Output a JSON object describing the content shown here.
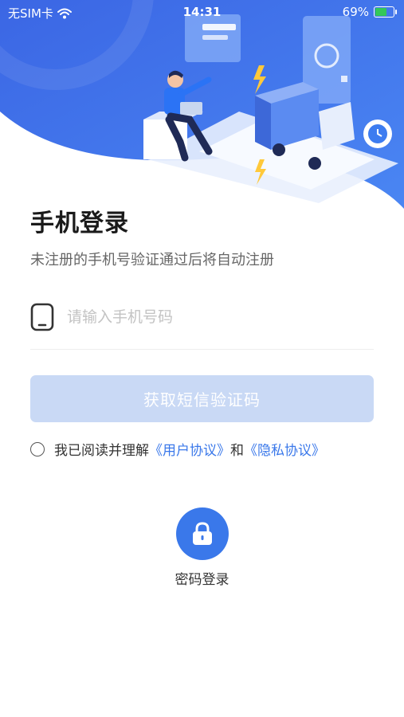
{
  "status_bar": {
    "carrier": "无SIM卡",
    "time": "14:31",
    "battery": "69%",
    "battery_level": 0.69
  },
  "page": {
    "title": "手机登录",
    "subtitle": "未注册的手机号验证通过后将自动注册"
  },
  "phone_field": {
    "placeholder": "请输入手机号码",
    "value": ""
  },
  "sms_button": {
    "label": "获取短信验证码"
  },
  "agreement": {
    "prefix": "我已阅读并理解",
    "user_agreement": "《用户协议》",
    "conjunction": "和",
    "privacy_policy": "《隐私协议》"
  },
  "password_login": {
    "label": "密码登录",
    "icon": "lock-icon"
  },
  "colors": {
    "accent": "#3a78ea",
    "banner": "#3f6fe6",
    "button_disabled": "#c9d9f5"
  }
}
